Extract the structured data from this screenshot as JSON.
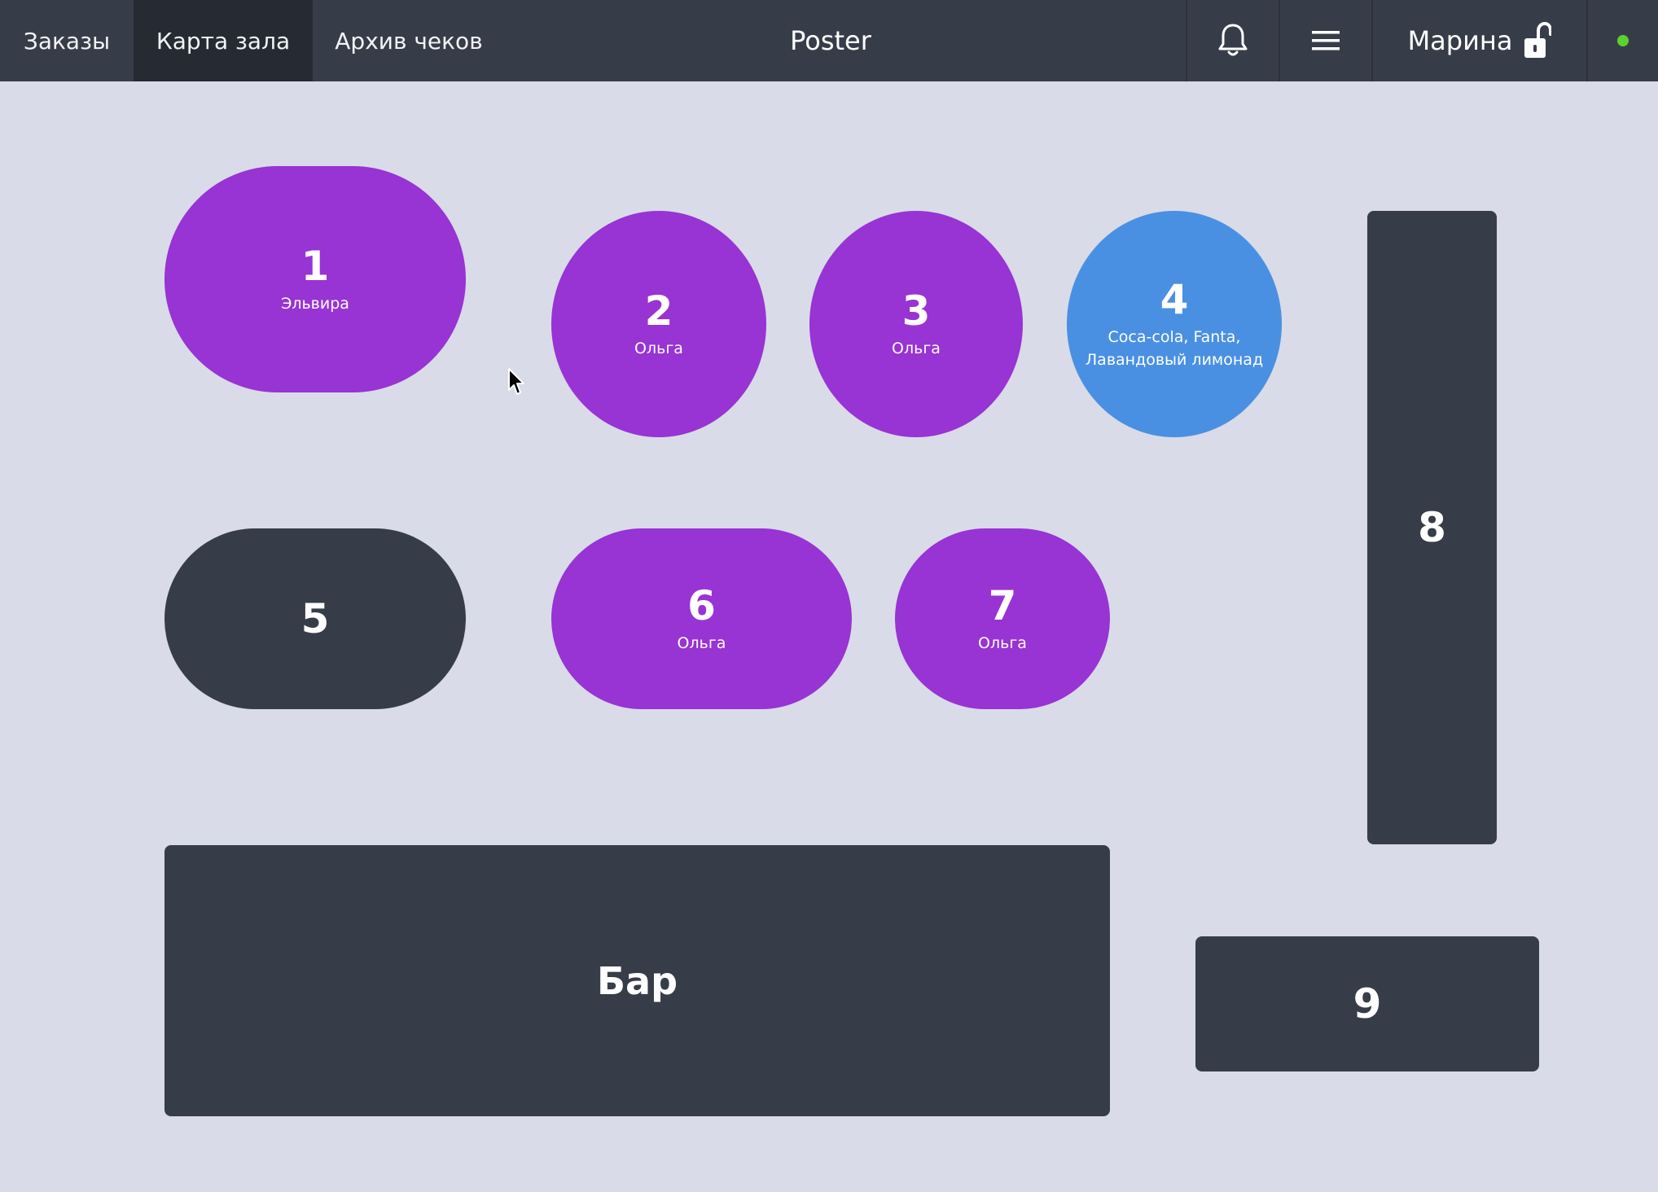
{
  "nav": {
    "tabs": [
      {
        "label": "Заказы"
      },
      {
        "label": "Карта зала"
      },
      {
        "label": "Архив чеков"
      }
    ],
    "app_title": "Poster",
    "user_name": "Марина",
    "status_color": "#5bd12f"
  },
  "colors": {
    "occupied": "#9833d4",
    "ordered": "#4a90e2",
    "free": "#373d48",
    "background": "#d9dbe8"
  },
  "tables": [
    {
      "number": "1",
      "subtitle": "Эльвира",
      "status": "occupied"
    },
    {
      "number": "2",
      "subtitle": "Ольга",
      "status": "occupied"
    },
    {
      "number": "3",
      "subtitle": "Ольга",
      "status": "occupied"
    },
    {
      "number": "4",
      "subtitle": "Coca-cola, Fanta, Лавандовый лимонад",
      "status": "ordered"
    },
    {
      "number": "5",
      "subtitle": "",
      "status": "free"
    },
    {
      "number": "6",
      "subtitle": "Ольга",
      "status": "occupied"
    },
    {
      "number": "7",
      "subtitle": "Ольга",
      "status": "occupied"
    },
    {
      "number": "8",
      "subtitle": "",
      "status": "free"
    },
    {
      "number": "Бар",
      "subtitle": "",
      "status": "free"
    },
    {
      "number": "9",
      "subtitle": "",
      "status": "free"
    }
  ]
}
